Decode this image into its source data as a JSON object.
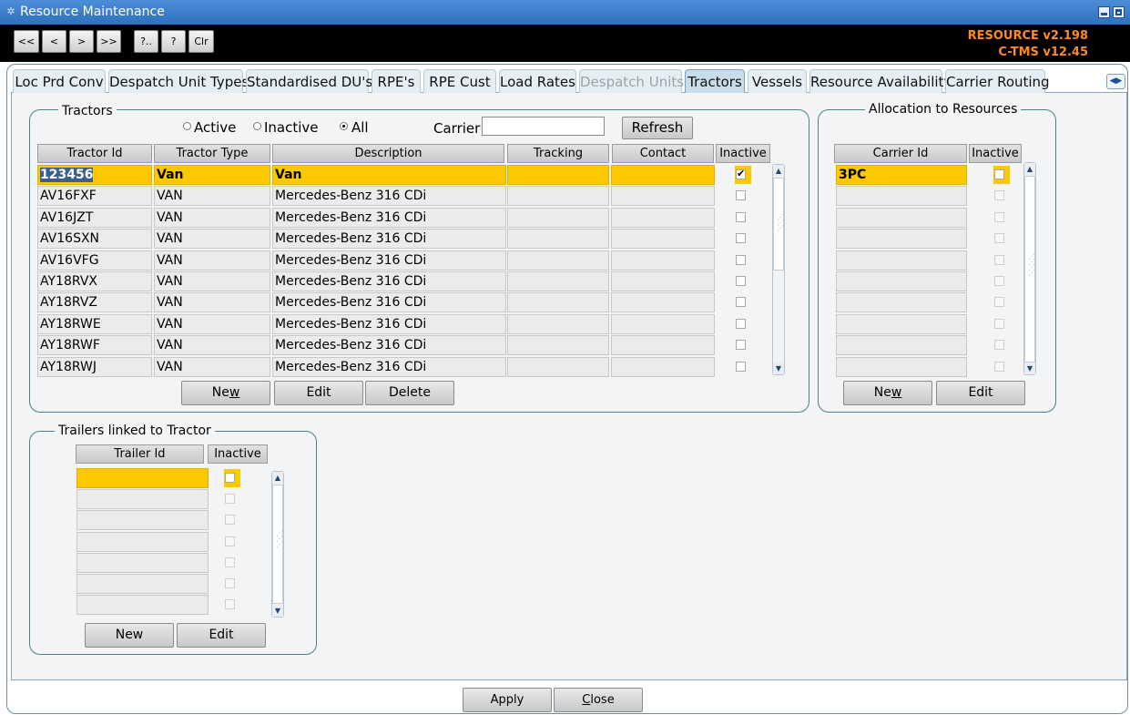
{
  "window": {
    "title": "Resource Maintenance"
  },
  "toolbar": {
    "buttons": [
      "<<",
      "<",
      ">",
      ">>",
      "?..",
      "?",
      "Clr"
    ],
    "version_resource": "RESOURCE v2.198",
    "version_ctms": "C-TMS v12.45"
  },
  "tabs": [
    {
      "label": "Loc Prd Conv",
      "state": "normal"
    },
    {
      "label": "Despatch Unit Types",
      "state": "normal"
    },
    {
      "label": "Standardised DU's",
      "state": "normal"
    },
    {
      "label": "RPE's",
      "state": "normal"
    },
    {
      "label": "RPE Cust",
      "state": "normal"
    },
    {
      "label": "Load Rates",
      "state": "normal"
    },
    {
      "label": "Despatch Units",
      "state": "disabled"
    },
    {
      "label": "Tractors",
      "state": "active"
    },
    {
      "label": "Vessels",
      "state": "normal"
    },
    {
      "label": "Resource Availability",
      "state": "normal"
    },
    {
      "label": "Carrier Routing",
      "state": "normal"
    }
  ],
  "tractors": {
    "title": "Tractors",
    "filter": {
      "active": "Active",
      "inactive": "Inactive",
      "all": "All",
      "selected": "All"
    },
    "carrier_label": "Carrier",
    "carrier_value": "",
    "refresh": "Refresh",
    "columns": [
      "Tractor Id",
      "Tractor Type",
      "Description",
      "Tracking",
      "Contact",
      "Inactive"
    ],
    "rows": [
      {
        "id": "123456",
        "type": "Van",
        "desc": "Van",
        "tracking": "",
        "contact": "",
        "inactive": true
      },
      {
        "id": "AV16FXF",
        "type": "VAN",
        "desc": "Mercedes-Benz 316 CDi",
        "tracking": "",
        "contact": "",
        "inactive": false
      },
      {
        "id": "AV16JZT",
        "type": "VAN",
        "desc": "Mercedes-Benz 316 CDi",
        "tracking": "",
        "contact": "",
        "inactive": false
      },
      {
        "id": "AV16SXN",
        "type": "VAN",
        "desc": "Mercedes-Benz 316 CDi",
        "tracking": "",
        "contact": "",
        "inactive": false
      },
      {
        "id": "AV16VFG",
        "type": "VAN",
        "desc": "Mercedes-Benz 316 CDi",
        "tracking": "",
        "contact": "",
        "inactive": false
      },
      {
        "id": "AY18RVX",
        "type": "VAN",
        "desc": "Mercedes-Benz 316 CDi",
        "tracking": "",
        "contact": "",
        "inactive": false
      },
      {
        "id": "AY18RVZ",
        "type": "VAN",
        "desc": "Mercedes-Benz 316 CDi",
        "tracking": "",
        "contact": "",
        "inactive": false
      },
      {
        "id": "AY18RWE",
        "type": "VAN",
        "desc": "Mercedes-Benz 316 CDi",
        "tracking": "",
        "contact": "",
        "inactive": false
      },
      {
        "id": "AY18RWF",
        "type": "VAN",
        "desc": "Mercedes-Benz 316 CDi",
        "tracking": "",
        "contact": "",
        "inactive": false
      },
      {
        "id": "AY18RWJ",
        "type": "VAN",
        "desc": "Mercedes-Benz 316 CDi",
        "tracking": "",
        "contact": "",
        "inactive": false
      }
    ],
    "buttons": {
      "new": "New",
      "edit": "Edit",
      "delete": "Delete"
    }
  },
  "allocation": {
    "title": "Allocation to Resources",
    "columns": [
      "Carrier Id",
      "Inactive"
    ],
    "rows": [
      "3PC",
      "",
      "",
      "",
      "",
      "",
      "",
      "",
      "",
      ""
    ],
    "buttons": {
      "new": "New",
      "edit": "Edit"
    }
  },
  "trailers": {
    "title": "Trailers linked to Tractor",
    "columns": [
      "Trailer Id",
      "Inactive"
    ],
    "rows": [
      "",
      "",
      "",
      "",
      "",
      "",
      ""
    ],
    "buttons": {
      "new": "New",
      "edit": "Edit"
    }
  },
  "footer": {
    "apply": "Apply",
    "close": "Close"
  },
  "colors": {
    "selection": "#fcc800",
    "title_bar": "#3a7ccc",
    "version_text": "#ff8a1f"
  }
}
